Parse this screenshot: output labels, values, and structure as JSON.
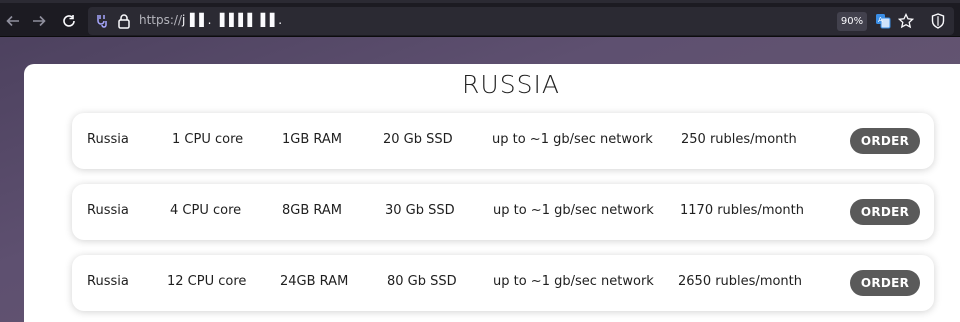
{
  "browser": {
    "url_scheme": "https://",
    "url_host": "j▐▐ . ▐▐▐▐ ▐▐ .",
    "zoom": "90%",
    "icons": {
      "back": "arrow-left-icon",
      "forward": "arrow-right-icon",
      "reload": "reload-icon",
      "permissions": "permissions-icon",
      "lock": "lock-icon",
      "translate": "translate-icon",
      "bookmark": "star-icon",
      "shield": "shield-icon"
    }
  },
  "page": {
    "title": "RUSSIA",
    "plans": [
      {
        "country": "Russia",
        "cpu": "1 CPU core",
        "ram": "1GB RAM",
        "disk": "20 Gb SSD",
        "network": "up to ~1 gb/sec network",
        "price": "250 rubles/month",
        "button": "ORDER"
      },
      {
        "country": "Russia",
        "cpu": "4 CPU core",
        "ram": "8GB RAM",
        "disk": "30 Gb SSD",
        "network": "up to ~1 gb/sec network",
        "price": "1170 rubles/month",
        "button": "ORDER"
      },
      {
        "country": "Russia",
        "cpu": "12 CPU core",
        "ram": "24GB RAM",
        "disk": "80 Gb SSD",
        "network": "up to ~1 gb/sec network",
        "price": "2650 rubles/month",
        "button": "ORDER"
      }
    ]
  },
  "colors": {
    "button_bg": "#5a5a5a",
    "page_bg": "#5e5070",
    "toolbar_bg": "#1c1b22"
  }
}
